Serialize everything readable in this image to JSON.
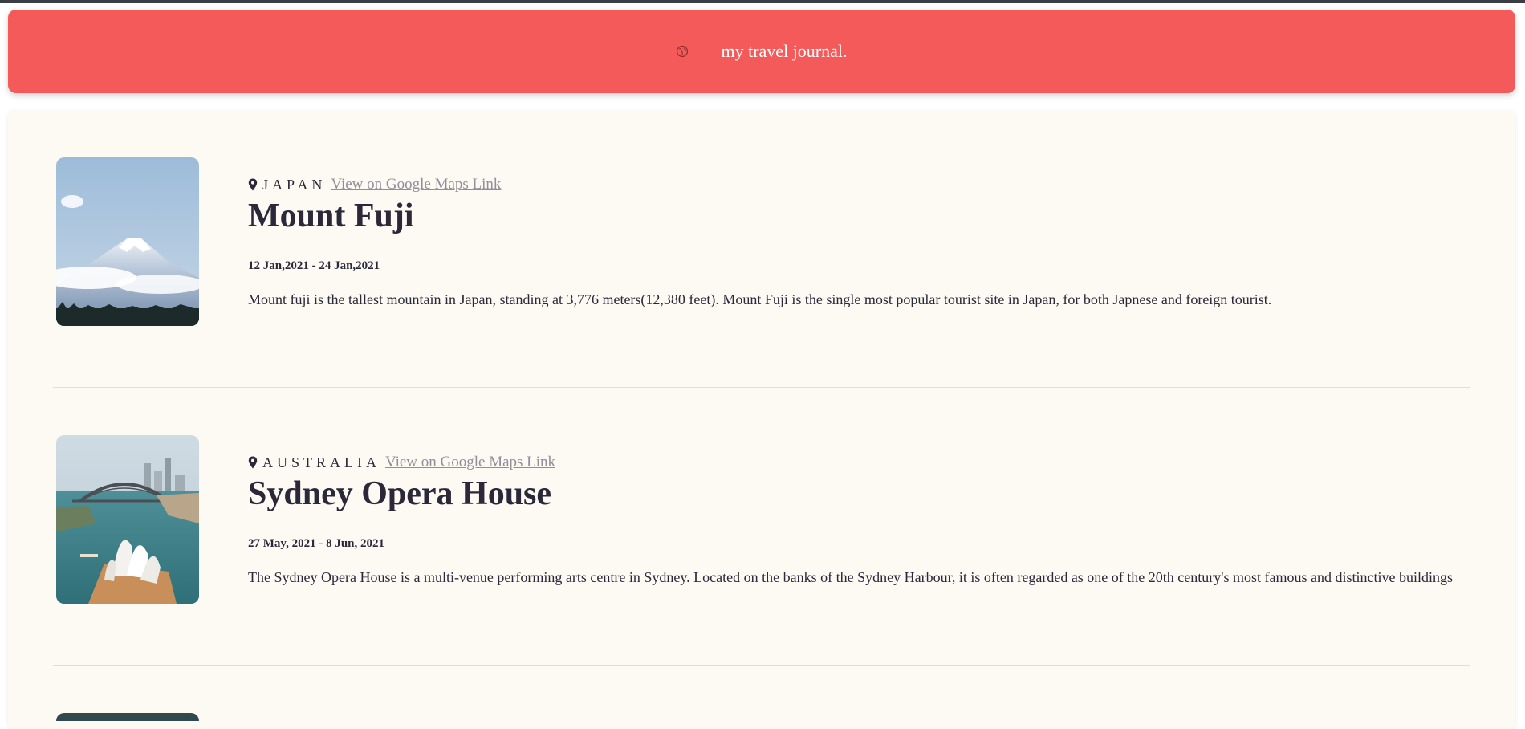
{
  "header": {
    "icon": "globe-icon",
    "title": "my travel journal."
  },
  "entries": [
    {
      "country": "JAPAN",
      "maps_link": "View on Google Maps Link",
      "title": "Mount Fuji",
      "dates": "12 Jan,2021 - 24 Jan,2021",
      "description": "Mount fuji is the tallest mountain in Japan, standing at 3,776 meters(12,380 feet). Mount Fuji is the single most popular tourist site in Japan, for both Japnese and foreign tourist.",
      "photo": "mount-fuji-photo"
    },
    {
      "country": "AUSTRALIA",
      "maps_link": "View on Google Maps Link",
      "title": "Sydney Opera House",
      "dates": "27 May, 2021 - 8 Jun, 2021",
      "description": "The Sydney Opera House is a multi-venue performing arts centre in Sydney. Located on the banks of the Sydney Harbour, it is often regarded as one of the 20th century's most famous and distinctive buildings",
      "photo": "sydney-opera-house-photo"
    }
  ],
  "colors": {
    "header_bg": "#f55a5a",
    "page_bg": "#fdf9f3",
    "text_dark": "#2b283a",
    "link_gray": "#918e9b"
  }
}
